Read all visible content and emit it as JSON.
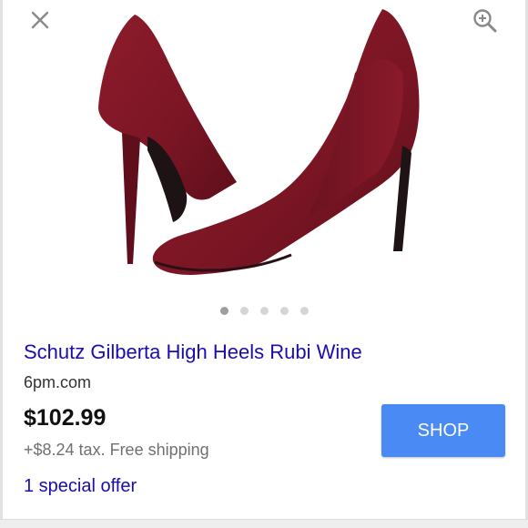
{
  "icons": {
    "close": "close-icon",
    "zoom": "zoom-in-icon"
  },
  "carousel": {
    "total": 5,
    "active_index": 0
  },
  "product": {
    "title": "Schutz Gilberta High Heels Rubi Wine",
    "merchant": "6pm.com",
    "price": "$102.99",
    "tax_shipping": "+$8.24 tax. Free shipping",
    "special_offer": "1 special offer",
    "image_color": "#7d1625"
  },
  "actions": {
    "shop_label": "SHOP"
  },
  "colors": {
    "link": "#1a0dab",
    "shop_button": "#4a8af4"
  }
}
